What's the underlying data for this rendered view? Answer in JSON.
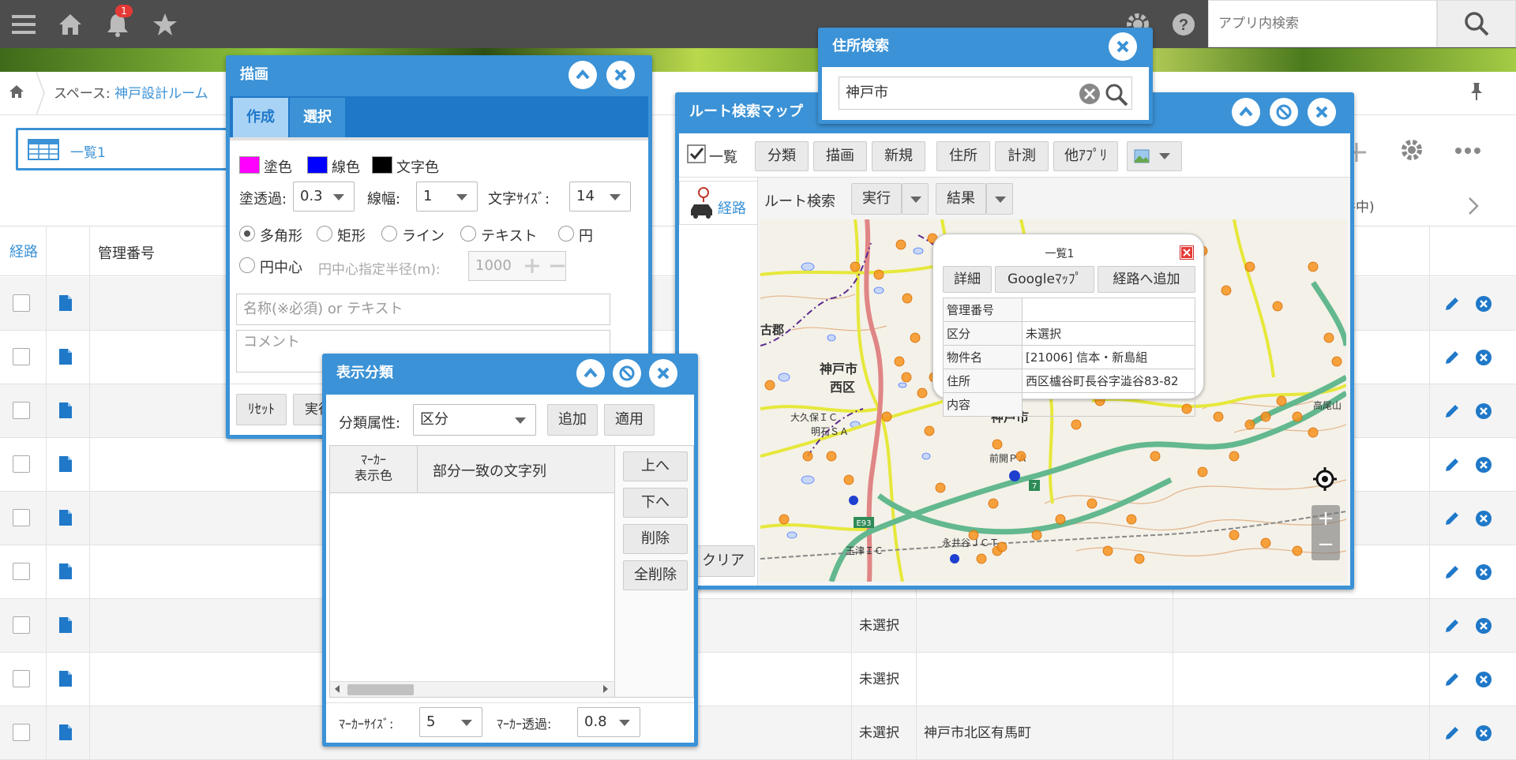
{
  "header": {
    "notification_count": "1",
    "search_placeholder": "アプリ内検索",
    "icons": [
      "menu-icon",
      "home-icon",
      "bell-icon",
      "star-icon",
      "gear-icon",
      "help-icon",
      "search-icon"
    ]
  },
  "breadcrumb": {
    "space_label": "スペース: ",
    "space_name": "神戸設計ルーム"
  },
  "view": {
    "name": "一覧1",
    "count_text": "件中)"
  },
  "table": {
    "headers": [
      "経路",
      "",
      "管理番号"
    ],
    "rows": [
      {
        "category": "",
        "address": ""
      },
      {
        "category": "",
        "address": ""
      },
      {
        "category": "",
        "address": ""
      },
      {
        "category": "",
        "address": ""
      },
      {
        "category": "",
        "address": ""
      },
      {
        "category": "",
        "address": ""
      },
      {
        "category": "未選択",
        "address": ""
      },
      {
        "category": "未選択",
        "address": ""
      },
      {
        "category": "未選択",
        "address": "神戸市北区有馬町"
      }
    ]
  },
  "draw_window": {
    "title": "描画",
    "tabs": [
      "作成",
      "選択"
    ],
    "fill_label": "塗色",
    "line_label": "線色",
    "text_color_label": "文字色",
    "fill_color": "#ff00ff",
    "line_color": "#0000ff",
    "text_color": "#000000",
    "opacity_label": "塗透過:",
    "opacity_value": "0.3",
    "width_label": "線幅:",
    "width_value": "1",
    "fontsize_label": "文字ｻｲｽﾞ:",
    "fontsize_value": "14",
    "shapes": [
      "多角形",
      "矩形",
      "ライン",
      "テキスト",
      "円",
      "円中心"
    ],
    "radius_label": "円中心指定半径(m):",
    "radius_value": "1000",
    "name_placeholder": "名称(※必須)  or  テキスト",
    "comment_placeholder": "コメント",
    "reset_label": "ﾘｾｯﾄ",
    "exec_label": "実行"
  },
  "classify_window": {
    "title": "表示分類",
    "attr_label": "分類属性:",
    "attr_value": "区分",
    "add_label": "追加",
    "apply_label": "適用",
    "col_marker": "ﾏｰｶｰ\n表示色",
    "col_text": "部分一致の文字列",
    "up_label": "上へ",
    "down_label": "下へ",
    "delete_label": "削除",
    "delete_all_label": "全削除",
    "marker_size_label": "ﾏｰｶｰｻｲｽﾞ:",
    "marker_size_value": "5",
    "marker_opacity_label": "ﾏｰｶｰ透過:",
    "marker_opacity_value": "0.8"
  },
  "route_window": {
    "title": "ルート検索マップ",
    "toolbar": [
      "一覧",
      "分類",
      "描画",
      "新規",
      "住所",
      "計測",
      "他ｱﾌﾟﾘ"
    ],
    "side_tab": "経路",
    "route_search_label": "ルート検索",
    "exec_label": "実行",
    "result_label": "結果",
    "clear_label": "クリア",
    "map_labels": [
      "神戸市",
      "西区",
      "神戸市",
      "古郡",
      "大久保ＩＣ",
      "明石ＳＡ",
      "前開ＰＡ",
      "永井谷ＪＣＴ",
      "玉津ＩＣ",
      "高尾山",
      "E93",
      "7"
    ],
    "popup": {
      "title": "一覧1",
      "buttons": [
        "詳細",
        "Googleﾏｯﾌﾟ",
        "経路へ追加"
      ],
      "rows": [
        {
          "key": "管理番号",
          "value": ""
        },
        {
          "key": "区分",
          "value": "未選択"
        },
        {
          "key": "物件名",
          "value": "[21006] 信本・新島組"
        },
        {
          "key": "住所",
          "value": "西区櫨谷町長谷字澁谷83-82"
        },
        {
          "key": "内容",
          "value": ""
        }
      ]
    }
  },
  "address_window": {
    "title": "住所検索",
    "query": "神戸市"
  },
  "colors": {
    "accent": "#3b92d6",
    "header": "#4d4d4d",
    "marker": "#f7931e"
  }
}
